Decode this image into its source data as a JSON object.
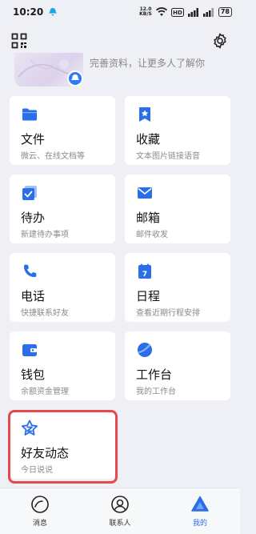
{
  "status_bar": {
    "time": "10:20",
    "speed_value": "12.0",
    "speed_unit": "KB/S",
    "battery": "78"
  },
  "profile": {
    "hint": "完善资料，让更多人了解你"
  },
  "cards": [
    {
      "title": "文件",
      "subtitle": "微云、在线文档等",
      "icon": "folder-icon"
    },
    {
      "title": "收藏",
      "subtitle": "文本图片链接语音",
      "icon": "bookmark-star-icon"
    },
    {
      "title": "待办",
      "subtitle": "新建待办事项",
      "icon": "todo-checkbox-icon"
    },
    {
      "title": "邮箱",
      "subtitle": "邮件收发",
      "icon": "mail-icon"
    },
    {
      "title": "电话",
      "subtitle": "快捷联系好友",
      "icon": "phone-icon"
    },
    {
      "title": "日程",
      "subtitle": "查看近期行程安排",
      "icon": "calendar-icon"
    },
    {
      "title": "钱包",
      "subtitle": "余额资金管理",
      "icon": "wallet-icon"
    },
    {
      "title": "工作台",
      "subtitle": "我的工作台",
      "icon": "workbench-icon"
    },
    {
      "title": "好友动态",
      "subtitle": "今日说说",
      "icon": "friend-feed-star-icon"
    }
  ],
  "calendar_day": "7",
  "nav": {
    "messages": "消息",
    "contacts": "联系人",
    "me": "我的"
  },
  "colors": {
    "accent": "#2a6ee8",
    "highlight": "#e8484d"
  }
}
